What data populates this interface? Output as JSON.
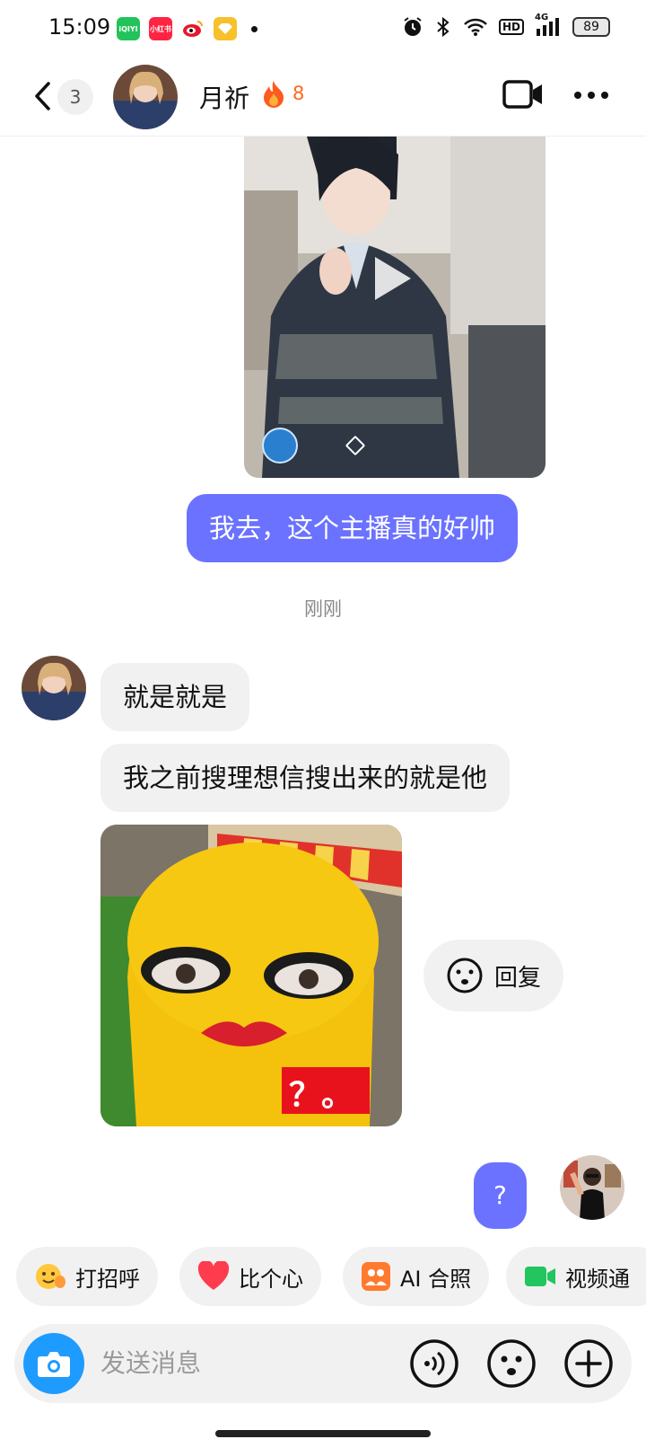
{
  "status_bar": {
    "time": "15:09",
    "apps": [
      {
        "name": "iqiyi-icon",
        "label": "iQIYI",
        "color": "#22c35a"
      },
      {
        "name": "xiaohongshu-icon",
        "label": "小红书",
        "color": "#ff2442"
      },
      {
        "name": "weibo-icon",
        "label": "",
        "color": "#ffffff"
      },
      {
        "name": "diamond-app-icon",
        "label": "",
        "color": "#f6c12a"
      }
    ],
    "hd_label": "HD",
    "network_label": "4G",
    "battery": "89"
  },
  "header": {
    "unread_count": "3",
    "contact_name": "月祈",
    "streak": "8"
  },
  "messages": [
    {
      "type": "video",
      "from": "me"
    },
    {
      "type": "text",
      "from": "me",
      "text": "我去，这个主播真的好帅"
    },
    {
      "type": "timestamp",
      "text": "刚刚"
    },
    {
      "type": "text",
      "from": "them",
      "text": "就是就是"
    },
    {
      "type": "text",
      "from": "them",
      "text": "我之前搜理想信搜出来的就是他"
    },
    {
      "type": "sticker",
      "from": "them",
      "caption": "？。"
    },
    {
      "type": "text",
      "from": "me",
      "text": "?"
    }
  ],
  "reply_button": {
    "label": "回复"
  },
  "quick_replies": [
    {
      "label": "打招呼",
      "icon": "waving-emoji-icon"
    },
    {
      "label": "比个心",
      "icon": "heart-icon"
    },
    {
      "label": "AI 合照",
      "icon": "ai-photo-icon"
    },
    {
      "label": "视频通",
      "icon": "video-camera-icon"
    }
  ],
  "input": {
    "placeholder": "发送消息"
  },
  "colors": {
    "my_bubble": "#6a72ff",
    "their_bubble": "#f1f1f1",
    "accent": "#1e9bff",
    "streak": "#ff6a1c"
  }
}
